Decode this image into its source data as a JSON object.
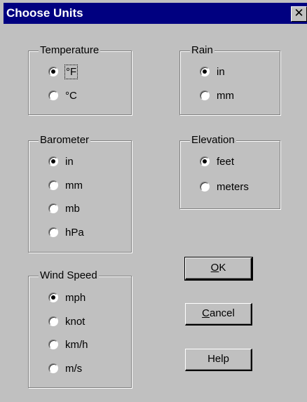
{
  "window": {
    "title": "Choose Units",
    "close_glyph": "✕"
  },
  "groups": {
    "temperature": {
      "label": "Temperature",
      "options": [
        "°F",
        "°C"
      ],
      "selected": "°F"
    },
    "rain": {
      "label": "Rain",
      "options": [
        "in",
        "mm"
      ],
      "selected": "in"
    },
    "barometer": {
      "label": "Barometer",
      "options": [
        "in",
        "mm",
        "mb",
        "hPa"
      ],
      "selected": "in"
    },
    "elevation": {
      "label": "Elevation",
      "options": [
        "feet",
        "meters"
      ],
      "selected": "feet"
    },
    "wind_speed": {
      "label": "Wind Speed",
      "options": [
        "mph",
        "knot",
        "km/h",
        "m/s"
      ],
      "selected": "mph"
    }
  },
  "buttons": {
    "ok": {
      "mnemonic": "O",
      "rest": "K"
    },
    "cancel": {
      "mnemonic": "C",
      "rest": "ancel"
    },
    "help": {
      "label": "Help"
    }
  },
  "colors": {
    "face": "#c0c0c0",
    "title_bar": "#000080",
    "title_text": "#ffffff"
  }
}
